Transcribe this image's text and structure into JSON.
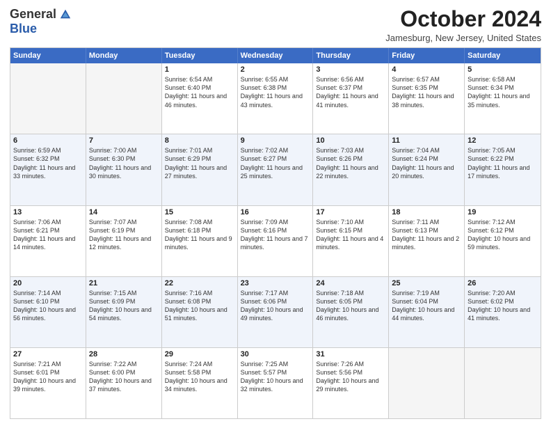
{
  "logo": {
    "general": "General",
    "blue": "Blue"
  },
  "header": {
    "month": "October 2024",
    "location": "Jamesburg, New Jersey, United States"
  },
  "days": [
    "Sunday",
    "Monday",
    "Tuesday",
    "Wednesday",
    "Thursday",
    "Friday",
    "Saturday"
  ],
  "weeks": [
    [
      {
        "day": "",
        "info": ""
      },
      {
        "day": "",
        "info": ""
      },
      {
        "day": "1",
        "info": "Sunrise: 6:54 AM\nSunset: 6:40 PM\nDaylight: 11 hours and 46 minutes."
      },
      {
        "day": "2",
        "info": "Sunrise: 6:55 AM\nSunset: 6:38 PM\nDaylight: 11 hours and 43 minutes."
      },
      {
        "day": "3",
        "info": "Sunrise: 6:56 AM\nSunset: 6:37 PM\nDaylight: 11 hours and 41 minutes."
      },
      {
        "day": "4",
        "info": "Sunrise: 6:57 AM\nSunset: 6:35 PM\nDaylight: 11 hours and 38 minutes."
      },
      {
        "day": "5",
        "info": "Sunrise: 6:58 AM\nSunset: 6:34 PM\nDaylight: 11 hours and 35 minutes."
      }
    ],
    [
      {
        "day": "6",
        "info": "Sunrise: 6:59 AM\nSunset: 6:32 PM\nDaylight: 11 hours and 33 minutes."
      },
      {
        "day": "7",
        "info": "Sunrise: 7:00 AM\nSunset: 6:30 PM\nDaylight: 11 hours and 30 minutes."
      },
      {
        "day": "8",
        "info": "Sunrise: 7:01 AM\nSunset: 6:29 PM\nDaylight: 11 hours and 27 minutes."
      },
      {
        "day": "9",
        "info": "Sunrise: 7:02 AM\nSunset: 6:27 PM\nDaylight: 11 hours and 25 minutes."
      },
      {
        "day": "10",
        "info": "Sunrise: 7:03 AM\nSunset: 6:26 PM\nDaylight: 11 hours and 22 minutes."
      },
      {
        "day": "11",
        "info": "Sunrise: 7:04 AM\nSunset: 6:24 PM\nDaylight: 11 hours and 20 minutes."
      },
      {
        "day": "12",
        "info": "Sunrise: 7:05 AM\nSunset: 6:22 PM\nDaylight: 11 hours and 17 minutes."
      }
    ],
    [
      {
        "day": "13",
        "info": "Sunrise: 7:06 AM\nSunset: 6:21 PM\nDaylight: 11 hours and 14 minutes."
      },
      {
        "day": "14",
        "info": "Sunrise: 7:07 AM\nSunset: 6:19 PM\nDaylight: 11 hours and 12 minutes."
      },
      {
        "day": "15",
        "info": "Sunrise: 7:08 AM\nSunset: 6:18 PM\nDaylight: 11 hours and 9 minutes."
      },
      {
        "day": "16",
        "info": "Sunrise: 7:09 AM\nSunset: 6:16 PM\nDaylight: 11 hours and 7 minutes."
      },
      {
        "day": "17",
        "info": "Sunrise: 7:10 AM\nSunset: 6:15 PM\nDaylight: 11 hours and 4 minutes."
      },
      {
        "day": "18",
        "info": "Sunrise: 7:11 AM\nSunset: 6:13 PM\nDaylight: 11 hours and 2 minutes."
      },
      {
        "day": "19",
        "info": "Sunrise: 7:12 AM\nSunset: 6:12 PM\nDaylight: 10 hours and 59 minutes."
      }
    ],
    [
      {
        "day": "20",
        "info": "Sunrise: 7:14 AM\nSunset: 6:10 PM\nDaylight: 10 hours and 56 minutes."
      },
      {
        "day": "21",
        "info": "Sunrise: 7:15 AM\nSunset: 6:09 PM\nDaylight: 10 hours and 54 minutes."
      },
      {
        "day": "22",
        "info": "Sunrise: 7:16 AM\nSunset: 6:08 PM\nDaylight: 10 hours and 51 minutes."
      },
      {
        "day": "23",
        "info": "Sunrise: 7:17 AM\nSunset: 6:06 PM\nDaylight: 10 hours and 49 minutes."
      },
      {
        "day": "24",
        "info": "Sunrise: 7:18 AM\nSunset: 6:05 PM\nDaylight: 10 hours and 46 minutes."
      },
      {
        "day": "25",
        "info": "Sunrise: 7:19 AM\nSunset: 6:04 PM\nDaylight: 10 hours and 44 minutes."
      },
      {
        "day": "26",
        "info": "Sunrise: 7:20 AM\nSunset: 6:02 PM\nDaylight: 10 hours and 41 minutes."
      }
    ],
    [
      {
        "day": "27",
        "info": "Sunrise: 7:21 AM\nSunset: 6:01 PM\nDaylight: 10 hours and 39 minutes."
      },
      {
        "day": "28",
        "info": "Sunrise: 7:22 AM\nSunset: 6:00 PM\nDaylight: 10 hours and 37 minutes."
      },
      {
        "day": "29",
        "info": "Sunrise: 7:24 AM\nSunset: 5:58 PM\nDaylight: 10 hours and 34 minutes."
      },
      {
        "day": "30",
        "info": "Sunrise: 7:25 AM\nSunset: 5:57 PM\nDaylight: 10 hours and 32 minutes."
      },
      {
        "day": "31",
        "info": "Sunrise: 7:26 AM\nSunset: 5:56 PM\nDaylight: 10 hours and 29 minutes."
      },
      {
        "day": "",
        "info": ""
      },
      {
        "day": "",
        "info": ""
      }
    ]
  ]
}
